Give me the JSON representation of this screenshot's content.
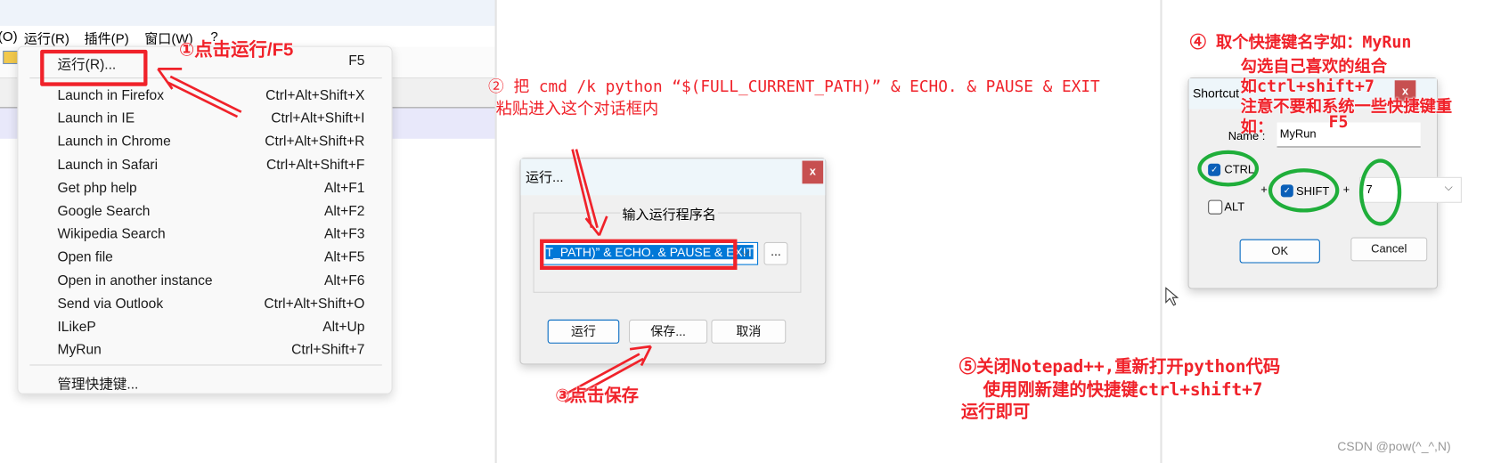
{
  "menubar": {
    "items": [
      "(O)",
      "运行(R)",
      "插件(P)",
      "窗口(W)",
      "?"
    ]
  },
  "run_menu": {
    "first": {
      "label": "运行(R)...",
      "shortcut": "F5"
    },
    "items": [
      {
        "label": "Launch in Firefox",
        "shortcut": "Ctrl+Alt+Shift+X"
      },
      {
        "label": "Launch in IE",
        "shortcut": "Ctrl+Alt+Shift+I"
      },
      {
        "label": "Launch in Chrome",
        "shortcut": "Ctrl+Alt+Shift+R"
      },
      {
        "label": "Launch in Safari",
        "shortcut": "Ctrl+Alt+Shift+F"
      },
      {
        "label": "Get php help",
        "shortcut": "Alt+F1"
      },
      {
        "label": "Google Search",
        "shortcut": "Alt+F2"
      },
      {
        "label": "Wikipedia Search",
        "shortcut": "Alt+F3"
      },
      {
        "label": "Open file",
        "shortcut": "Alt+F5"
      },
      {
        "label": "Open in another instance",
        "shortcut": "Alt+F6"
      },
      {
        "label": "Send via Outlook",
        "shortcut": "Ctrl+Alt+Shift+O"
      },
      {
        "label": "ILikeP",
        "shortcut": "Alt+Up"
      },
      {
        "label": "MyRun",
        "shortcut": "Ctrl+Shift+7"
      }
    ],
    "manage": "管理快捷键..."
  },
  "annotations": {
    "step1": "①点击运行/F5",
    "step2_line1": "② 把 cmd /k python “$(FULL_CURRENT_PATH)” & ECHO. & PAUSE & EXIT",
    "step2_line2": "粘贴进入这个对话框内",
    "step3": "③点击保存",
    "step4_line1": "④ 取个快捷键名字如：MyRun",
    "step4_line2": "勾选自己喜欢的组合",
    "step4_line3": "如ctrl+shift+7",
    "step4_line4": "注意不要和系统一些快捷键重",
    "step4_line5": "如：",
    "step4_line5b": "F5",
    "step5_line1": "⑤关闭Notepad++,重新打开python代码",
    "step5_line2": "使用刚新建的快捷键ctrl+shift+7",
    "step5_line3": "运行即可"
  },
  "run_dialog": {
    "title": "运行...",
    "close": "x",
    "group_label": "输入运行程序名",
    "command_value": "T_PATH)” & ECHO. & PAUSE & EXIT",
    "browse": "...",
    "run": "运行",
    "save": "保存...",
    "cancel": "取消"
  },
  "shortcut_dialog": {
    "title": "Shortcut",
    "close": "x",
    "name_label": "Name :",
    "name_value": "MyRun",
    "ctrl": "CTRL",
    "ctrl_checked": true,
    "alt": "ALT",
    "alt_checked": false,
    "shift": "SHIFT",
    "shift_checked": true,
    "plus": "+",
    "key_value": "7",
    "ok": "OK",
    "cancel": "Cancel"
  },
  "watermark": "CSDN @pow(^_^,N)",
  "colors": {
    "annotation": "#f0222a",
    "highlight_ellipse": "#1fae3a",
    "selection": "#0078d7"
  }
}
